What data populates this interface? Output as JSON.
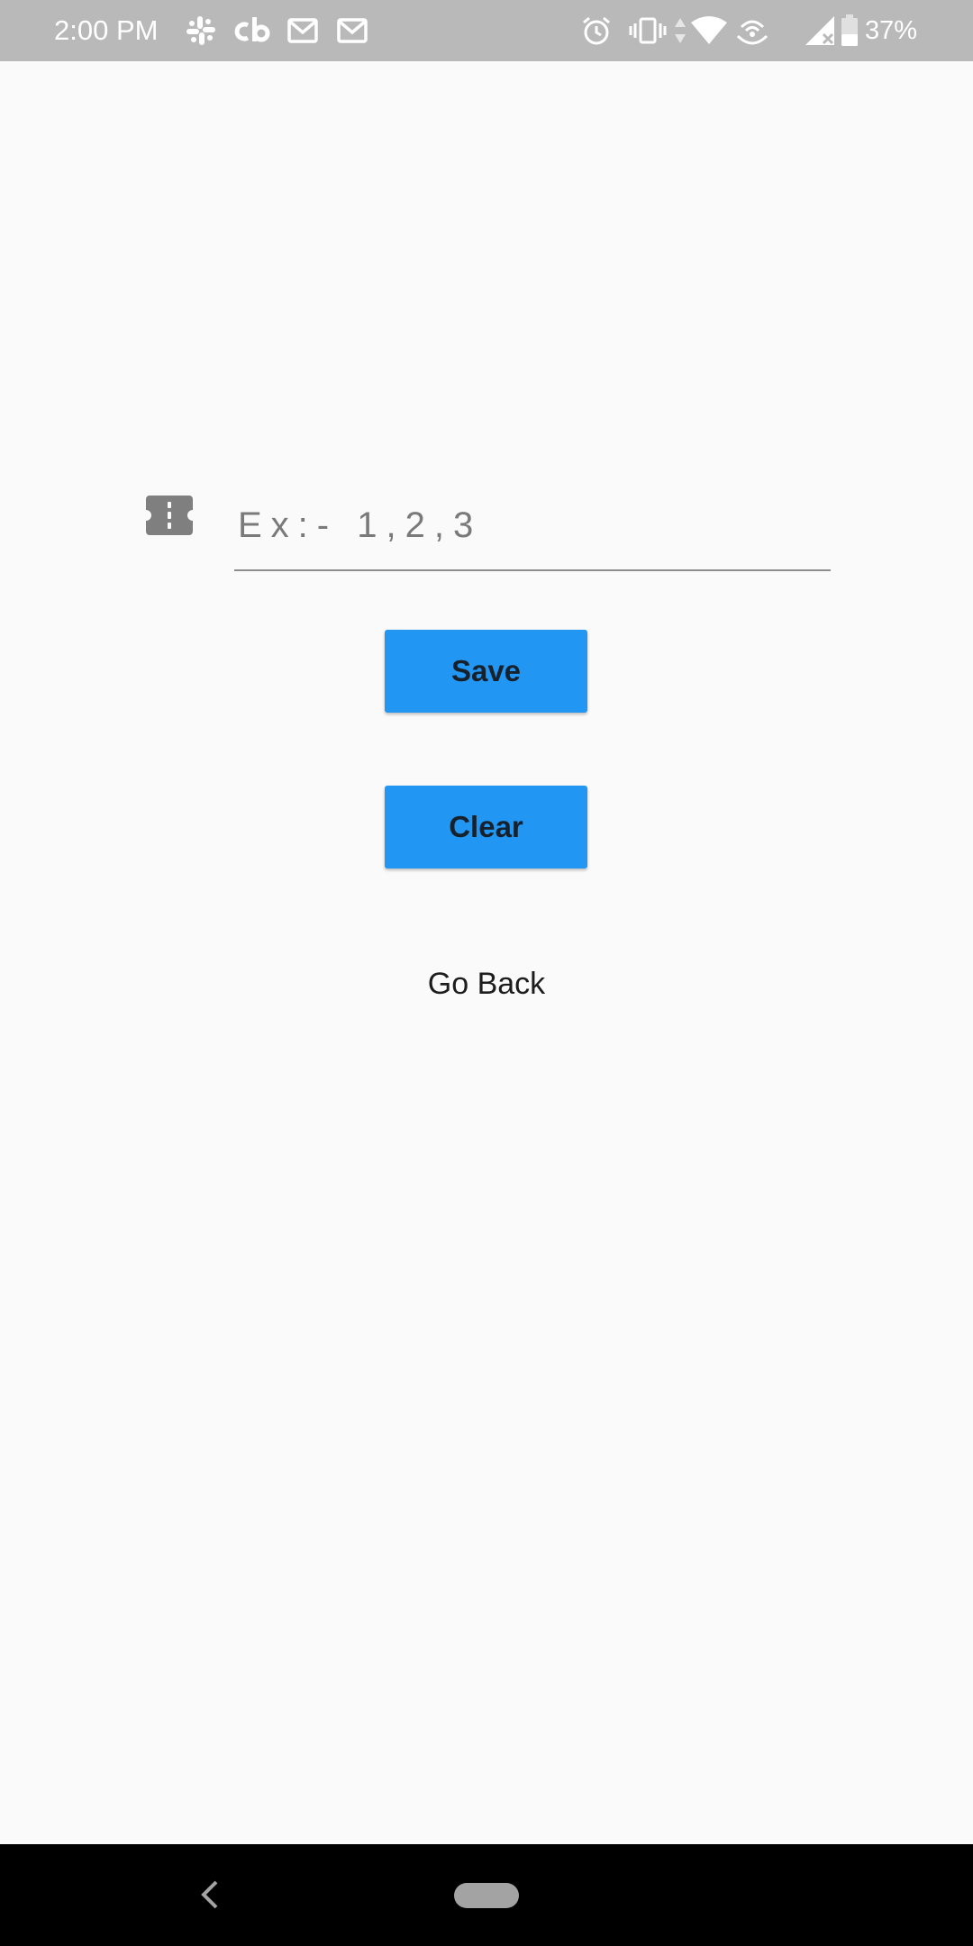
{
  "status_bar": {
    "time": "2:00 PM",
    "battery_percent": "37%",
    "notification_icons": [
      "slack-icon",
      "cb-icon",
      "gmail-icon",
      "gmail-icon"
    ],
    "system_icons": [
      "alarm-icon",
      "vibrate-icon",
      "data-arrows-icon",
      "wifi-icon",
      "hotspot-icon",
      "signal-no-service-icon",
      "battery-icon"
    ],
    "background_color": "#b9b9b9"
  },
  "form": {
    "field_icon": "ticket-icon",
    "input_value": "",
    "input_placeholder": "Ex:- 1,2,3",
    "save_label": "Save",
    "clear_label": "Clear",
    "go_back_label": "Go Back"
  },
  "colors": {
    "button_blue": "#2196f3",
    "background": "#fafafa",
    "nav_bar": "#000000"
  },
  "nav_bar": {
    "back_icon": "chevron-left-icon",
    "home_icon": "home-pill-icon"
  }
}
